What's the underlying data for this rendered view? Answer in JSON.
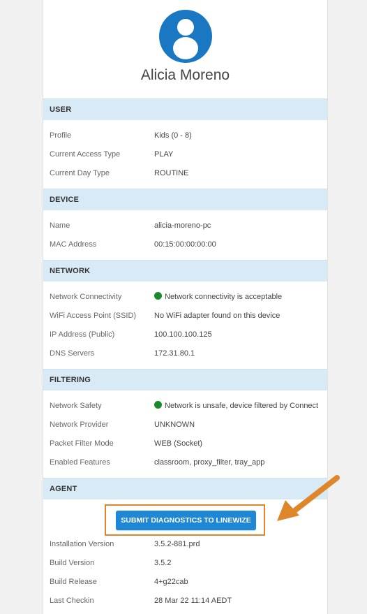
{
  "user_name": "Alicia Moreno",
  "sections": {
    "user": {
      "title": "USER",
      "rows": [
        {
          "label": "Profile",
          "value": "Kids (0 - 8)"
        },
        {
          "label": "Current Access Type",
          "value": "PLAY"
        },
        {
          "label": "Current Day Type",
          "value": "ROUTINE"
        }
      ]
    },
    "device": {
      "title": "DEVICE",
      "rows": [
        {
          "label": "Name",
          "value": "alicia-moreno-pc"
        },
        {
          "label": "MAC Address",
          "value": "00:15:00:00:00:00"
        }
      ]
    },
    "network": {
      "title": "NETWORK",
      "rows": [
        {
          "label": "Network Connectivity",
          "value": "Network connectivity is acceptable"
        },
        {
          "label": "WiFi Access Point (SSID)",
          "value": "No WiFi adapter found on this device"
        },
        {
          "label": "IP Address (Public)",
          "value": "100.100.100.125"
        },
        {
          "label": "DNS Servers",
          "value": "172.31.80.1"
        }
      ]
    },
    "filtering": {
      "title": "FILTERING",
      "rows": [
        {
          "label": "Network Safety",
          "value": "Network is unsafe, device filtered by Connect"
        },
        {
          "label": "Network Provider",
          "value": "UNKNOWN"
        },
        {
          "label": "Packet Filter Mode",
          "value": "WEB (Socket)"
        },
        {
          "label": "Enabled Features",
          "value": "classroom, proxy_filter, tray_app"
        }
      ]
    },
    "agent": {
      "title": "AGENT",
      "submit_label": "SUBMIT DIAGNOSTICS TO LINEWIZE",
      "rows": [
        {
          "label": "Installation Version",
          "value": "3.5.2-881.prd"
        },
        {
          "label": "Build Version",
          "value": "3.5.2"
        },
        {
          "label": "Build Release",
          "value": "4+g22cab"
        },
        {
          "label": "Last Checkin",
          "value": "28 Mar 22 11:14 AEDT"
        }
      ]
    }
  },
  "colors": {
    "accent": "#1e88d6",
    "section_header_bg": "#d8eaf6",
    "status_ok": "#1b8a2d",
    "annotation": "#e0862a"
  },
  "icons": {
    "avatar": "user-avatar-icon",
    "status": "status-dot-icon",
    "annotation": "arrow-icon"
  }
}
